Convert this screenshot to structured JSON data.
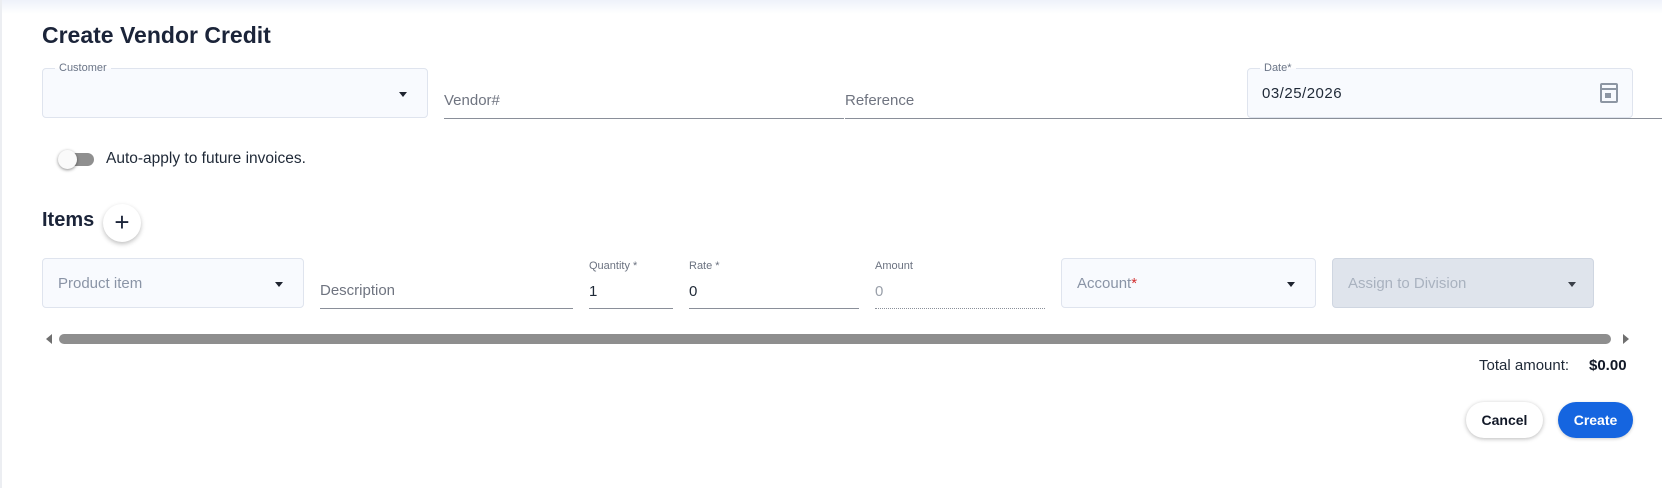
{
  "page": {
    "title": "Create Vendor Credit"
  },
  "form": {
    "customer": {
      "label": "Customer",
      "value": ""
    },
    "vendor_number": {
      "placeholder": "Vendor#"
    },
    "reference": {
      "placeholder": "Reference"
    },
    "date": {
      "label": "Date*",
      "value": "03/25/2026",
      "icon": "calendar-icon"
    },
    "auto_apply": {
      "label": "Auto-apply to future invoices.",
      "enabled": false
    }
  },
  "items": {
    "title": "Items",
    "add_icon": "+",
    "row": {
      "product_item": {
        "placeholder": "Product item"
      },
      "description": {
        "placeholder": "Description"
      },
      "quantity": {
        "label": "Quantity *",
        "value": "1"
      },
      "rate": {
        "label": "Rate *",
        "value": "0"
      },
      "amount": {
        "label": "Amount",
        "value": "0"
      },
      "account": {
        "placeholder": "Account",
        "required_mark": "*"
      },
      "division": {
        "placeholder": "Assign to Division",
        "disabled": true
      }
    }
  },
  "summary": {
    "total_label": "Total amount:",
    "total_value": "$0.00"
  },
  "actions": {
    "cancel_label": "Cancel",
    "create_label": "Create"
  },
  "colors": {
    "primary": "#1565e0",
    "required": "#d32f2f",
    "heading": "#1b2439"
  }
}
